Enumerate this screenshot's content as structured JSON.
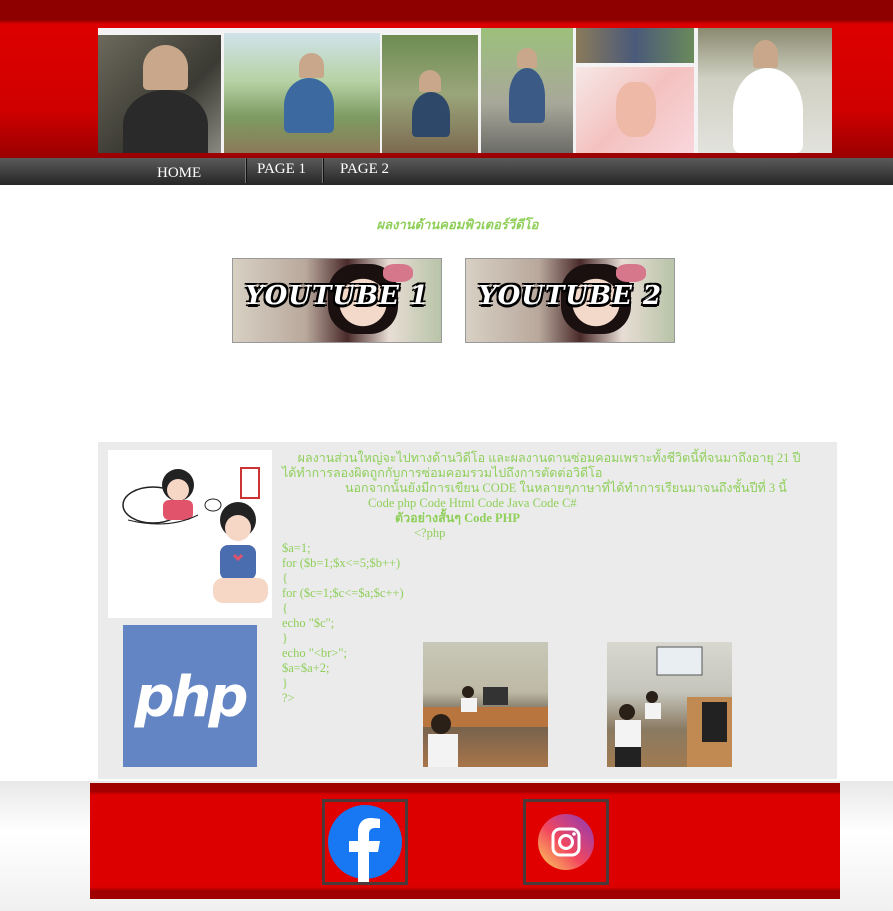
{
  "nav": {
    "items": [
      "HOME",
      "PAGE 1",
      "PAGE 2"
    ]
  },
  "section_title": "ผลงานด้านคอมพิวเตอร์วีดีโอ",
  "videos": [
    "YOUTUBE 1",
    "YOUTUBE 2"
  ],
  "about": {
    "lines": [
      "     ผลงานส่วนใหญ่จะไปทางด้านวิดีโอ และผลงานดานซ่อมคอมเพราะทั้งชีวิตนี้ที่จนมาถึงอายุ 21 ปี",
      "ได้ทำการลองผิดถูกกับการซ่อมคอมรวมไปถึงการตัดต่อวิดีโอ",
      "นอกจากนั้นยังมีการเขียน CODE ในหลายๆภาษาที่ได้ทำการเรียนมาจนถึงชั้นปีที่ 3 นี้",
      "Code php Code Html Code Java Code C#"
    ],
    "example_heading": "ตัวอย่างสั้นๆ Code PHP",
    "code_open": "<?php",
    "code": [
      "$a=1;",
      "for ($b=1;$x<=5;$b++)",
      "{",
      "for ($c=1;$c<=$a;$c++)",
      "{",
      "echo \"$c\";",
      "}",
      "echo \"<br>\";",
      "$a=$a+2;",
      "}",
      "?>"
    ]
  },
  "php_logo_text": "php",
  "colors": {
    "header_red": "#dd0000",
    "text_green": "#8fcf5a",
    "php_blue": "#6485c3",
    "facebook_blue": "#1877f2"
  },
  "icons": [
    "facebook-icon",
    "instagram-icon"
  ]
}
